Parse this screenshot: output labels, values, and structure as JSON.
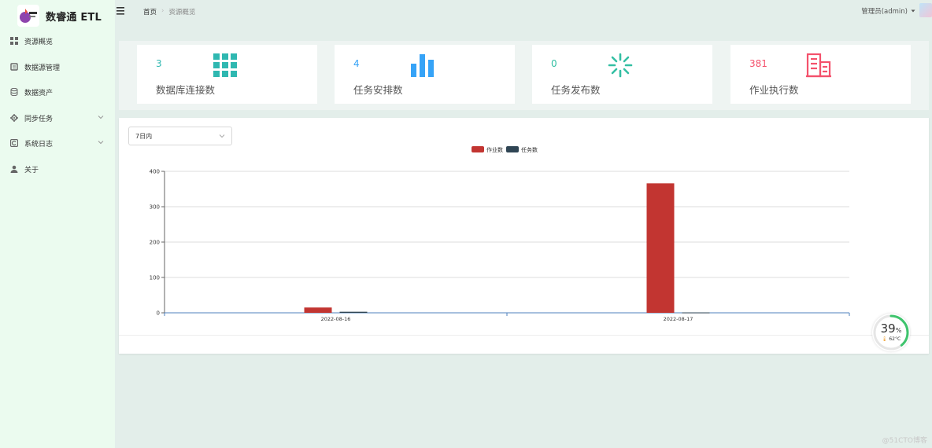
{
  "app": {
    "title": "数睿通 ETL"
  },
  "sidebar": {
    "items": [
      {
        "label": "资源概览",
        "icon": "dashboard-grid-icon"
      },
      {
        "label": "数据源管理",
        "icon": "database-manage-icon"
      },
      {
        "label": "数据资产",
        "icon": "database-icon"
      },
      {
        "label": "同步任务",
        "icon": "gear-icon",
        "expandable": true
      },
      {
        "label": "系统日志",
        "icon": "log-icon",
        "expandable": true
      },
      {
        "label": "关于",
        "icon": "user-icon"
      }
    ]
  },
  "header": {
    "breadcrumb": [
      "首页",
      "资源概览"
    ],
    "user": "管理员(admin)"
  },
  "stats": [
    {
      "value": "3",
      "label": "数据库连接数",
      "color": "#2fb8b1",
      "icon": "grid-icon"
    },
    {
      "value": "4",
      "label": "任务安排数",
      "color": "#36a3f7",
      "icon": "bar-chart-icon"
    },
    {
      "value": "0",
      "label": "任务发布数",
      "color": "#34bfa3",
      "icon": "loading-spinner-icon"
    },
    {
      "value": "381",
      "label": "作业执行数",
      "color": "#f4516c",
      "icon": "building-icon"
    }
  ],
  "filter": {
    "range": "7日内"
  },
  "chart_data": {
    "type": "bar",
    "categories": [
      "2022-08-16",
      "2022-08-17"
    ],
    "series": [
      {
        "name": "作业数",
        "values": [
          15,
          366
        ],
        "color": "#c23531"
      },
      {
        "name": "任务数",
        "values": [
          3,
          1
        ],
        "color": "#2f4554"
      }
    ],
    "ylim": [
      0,
      400
    ],
    "yticks": [
      0,
      100,
      200,
      300,
      400
    ],
    "grid": true,
    "legend": "top-center"
  },
  "gauge": {
    "percent": "39",
    "unit": "%",
    "temp": "62°C"
  },
  "watermark": "@51CTO博客"
}
